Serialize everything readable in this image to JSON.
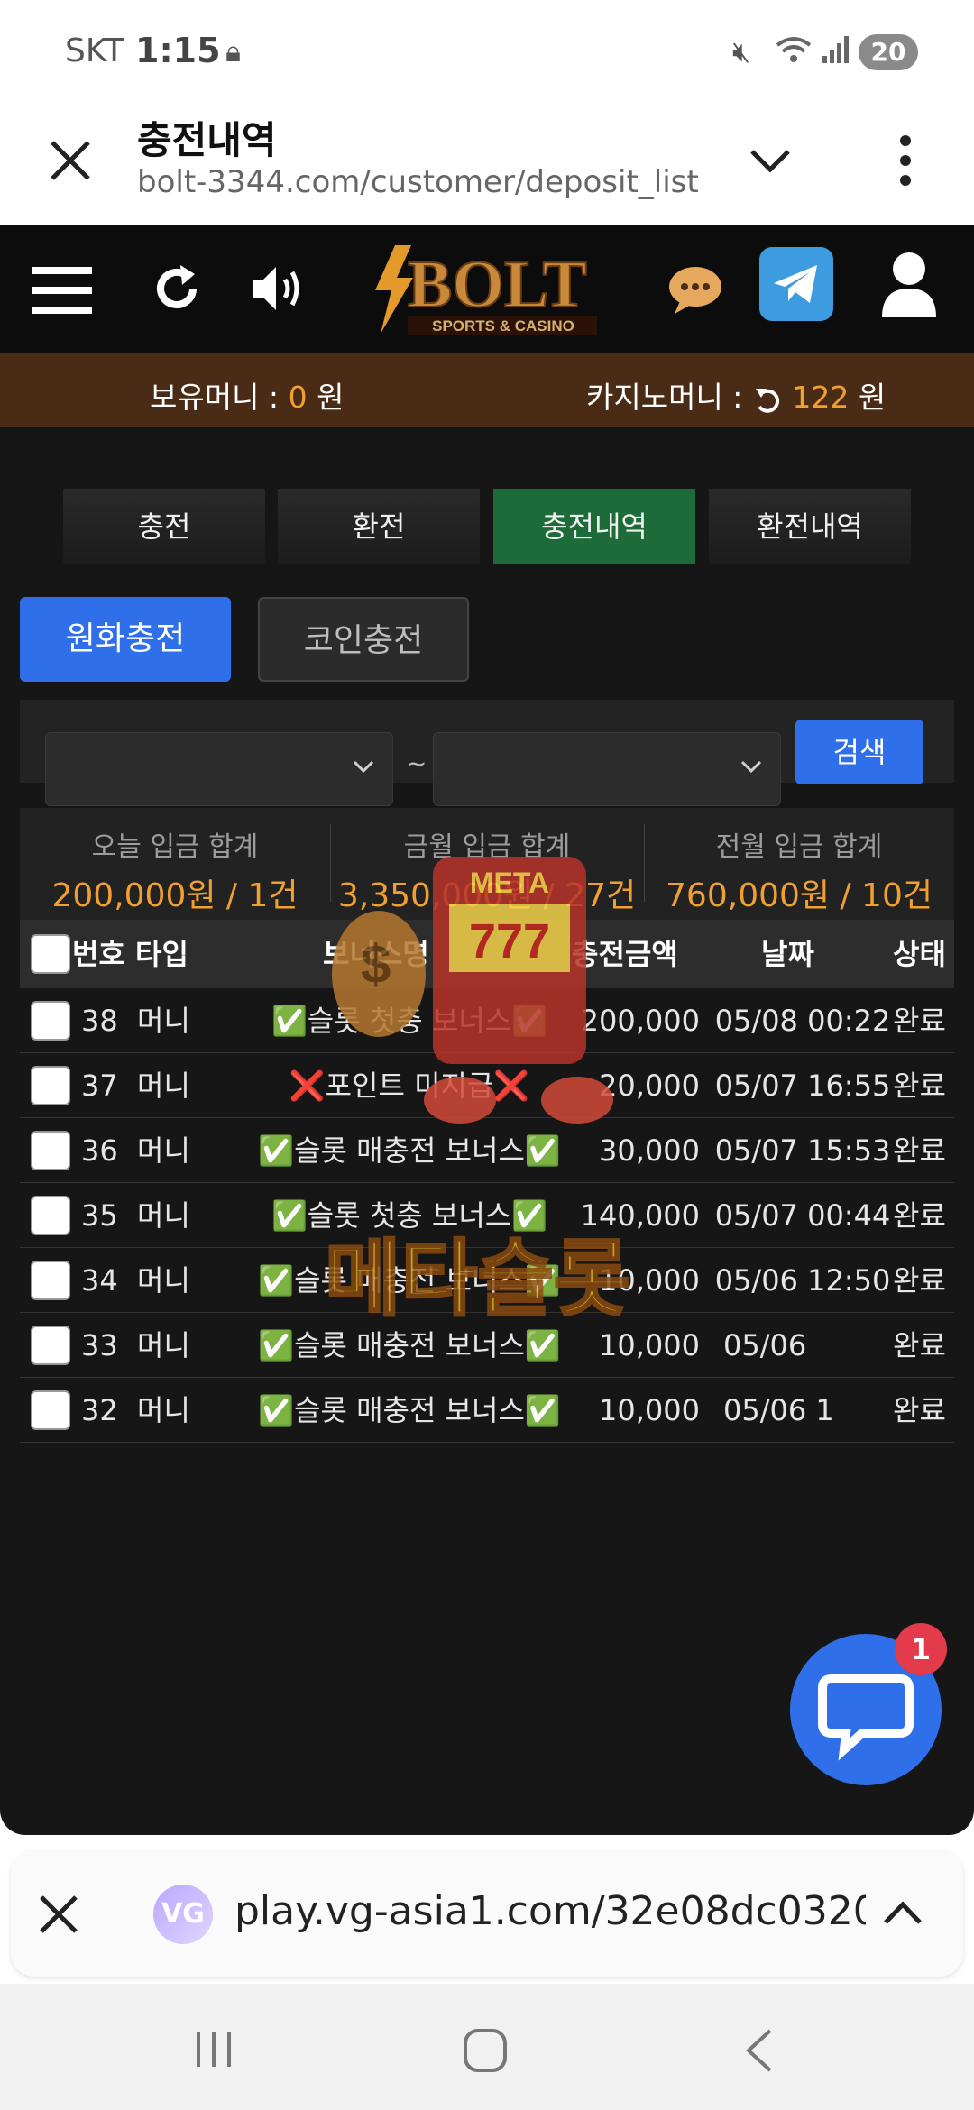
{
  "status_bar": {
    "carrier": "SKT",
    "time": "1:15",
    "battery": "20"
  },
  "browser": {
    "title": "충전내역",
    "url": "bolt-3344.com/customer/deposit_list"
  },
  "site": {
    "logo_main": "BOLT",
    "logo_sub": "SPORTS & CASINO",
    "money": {
      "label": "보유머니 :",
      "value": "0",
      "unit": "원"
    },
    "casino_money": {
      "label": "카지노머니 :",
      "value": "122",
      "unit": "원"
    },
    "tabs": [
      "충전",
      "환전",
      "충전내역",
      "환전내역"
    ],
    "sub_tabs": [
      "원화충전",
      "코인충전"
    ],
    "date_sep": "~",
    "search_label": "검색",
    "summary": [
      {
        "label": "오늘 입금 합계",
        "value": "200,000원 / 1건"
      },
      {
        "label": "금월 입금 합계",
        "value": "3,350,000원 / 27건"
      },
      {
        "label": "전월 입금 합계",
        "value": "760,000원 / 10건"
      }
    ],
    "table": {
      "headers": [
        "번호",
        "타입",
        "보너스명",
        "충전금액",
        "날짜",
        "상태"
      ],
      "rows": [
        {
          "no": "38",
          "type": "머니",
          "bonus": "✅슬롯 첫충 보너스✅",
          "amount": "200,000",
          "date": "05/08 00:22",
          "status": "완료"
        },
        {
          "no": "37",
          "type": "머니",
          "bonus": "❌포인트 미지급❌",
          "amount": "20,000",
          "date": "05/07 16:55",
          "status": "완료"
        },
        {
          "no": "36",
          "type": "머니",
          "bonus": "✅슬롯 매충전 보너스✅",
          "amount": "30,000",
          "date": "05/07 15:53",
          "status": "완료"
        },
        {
          "no": "35",
          "type": "머니",
          "bonus": "✅슬롯 첫충 보너스✅",
          "amount": "140,000",
          "date": "05/07 00:44",
          "status": "완료"
        },
        {
          "no": "34",
          "type": "머니",
          "bonus": "✅슬롯 매충전 보너스✅",
          "amount": "10,000",
          "date": "05/06 12:50",
          "status": "완료"
        },
        {
          "no": "33",
          "type": "머니",
          "bonus": "✅슬롯 매충전 보너스✅",
          "amount": "10,000",
          "date": "05/06",
          "status": "완료"
        },
        {
          "no": "32",
          "type": "머니",
          "bonus": "✅슬롯 매충전 보너스✅",
          "amount": "10,000",
          "date": "05/06 1",
          "status": "완료"
        }
      ]
    },
    "watermark": {
      "meta": "META",
      "slot": "777",
      "text": "메타슬롯"
    }
  },
  "chat_badge": "1",
  "bottom_tab": {
    "logo": "VG",
    "url": "play.vg-asia1.com/32e08dc0320"
  },
  "colors": {
    "accent": "#2f6fe9",
    "money_bar": "#4a2c16",
    "active_tab": "#1e6b3a",
    "orange": "#f0a030"
  }
}
